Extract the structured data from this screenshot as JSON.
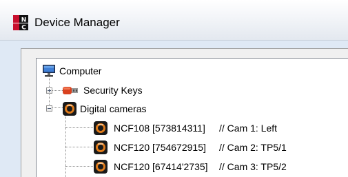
{
  "window": {
    "title": "Device Manager",
    "app_icon_letters": [
      "N",
      "C"
    ]
  },
  "tree": {
    "root": {
      "label": "Computer",
      "icon": "computer-icon"
    },
    "security_keys": {
      "label": "Security Keys",
      "icon": "security-key-icon",
      "expanded": false
    },
    "digital_cameras": {
      "label": "Digital cameras",
      "icon": "camera-icon",
      "expanded": true
    },
    "cameras": [
      {
        "label": "NCF108 [573814311]",
        "comment": "// Cam 1: Left",
        "icon": "camera-icon"
      },
      {
        "label": "NCF120 [754672915]",
        "comment": "// Cam 2: TP5/1",
        "icon": "camera-icon"
      },
      {
        "label": "NCF120 [67414'2735]",
        "comment": "// Cam 3: TP5/2",
        "icon": "camera-icon"
      }
    ]
  },
  "colors": {
    "title_bg": "#f4f6f9",
    "tree_bg": "#ffffff",
    "camera_orange": "#e07b1a",
    "key_red": "#d9411e"
  }
}
